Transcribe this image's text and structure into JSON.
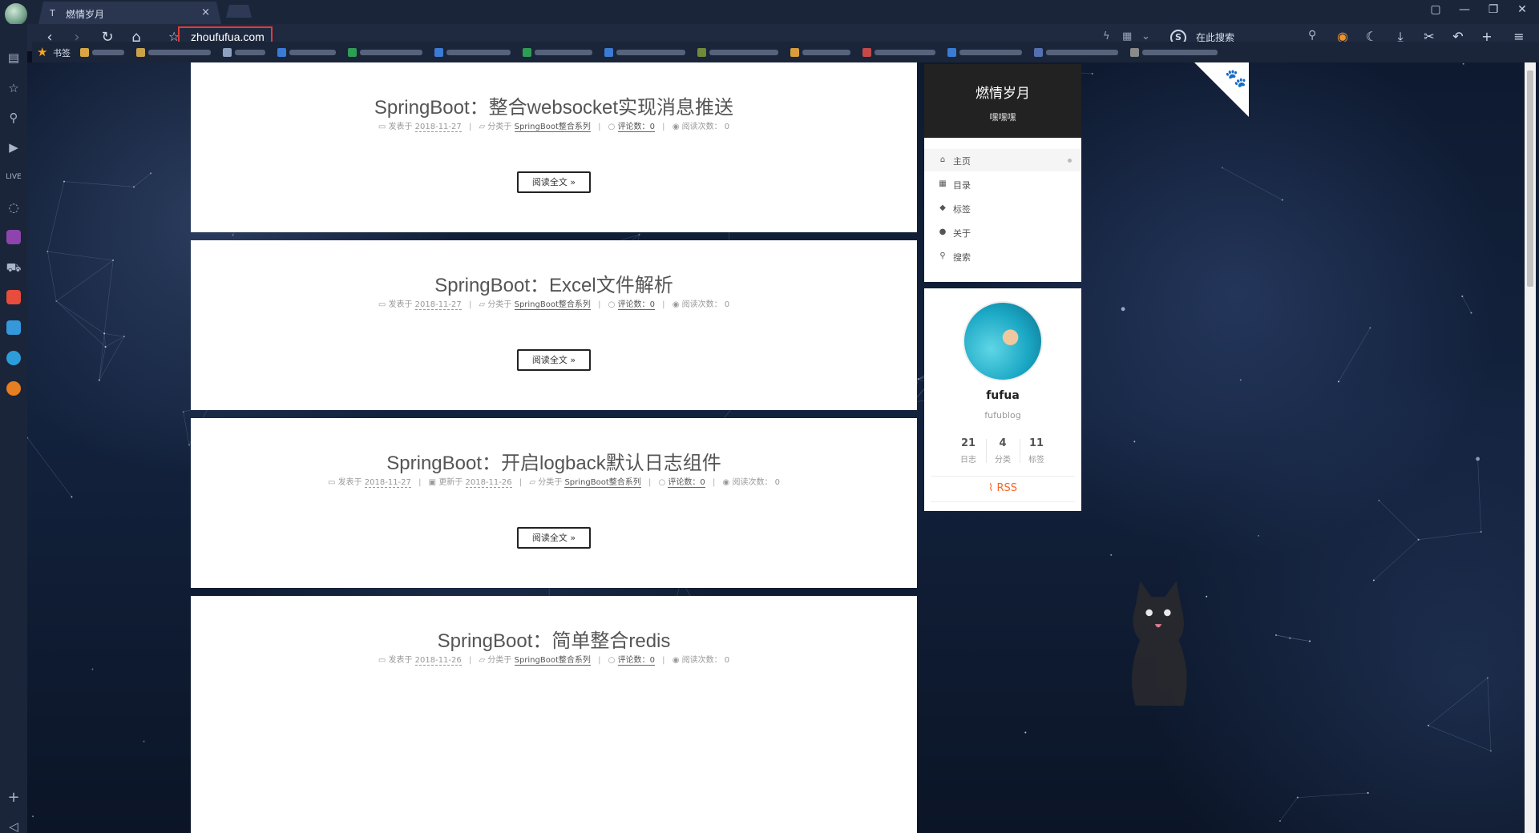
{
  "browser": {
    "tab": {
      "title": "燃情岁月",
      "close": "×"
    },
    "address": "zhoufufua.com",
    "search_placeholder": "在此搜索",
    "search_engine_glyph": "S",
    "window_controls": [
      "▢",
      "—",
      "❐",
      "✕"
    ],
    "bookmarks_label": "书签",
    "bookmark_colors": [
      "#d9a441",
      "#c9a24a",
      "#8fa0c0",
      "#3a7bd5",
      "#2e9d55",
      "#3a7bd5",
      "#2e9d55",
      "#3a7bd5",
      "#6e8a3a",
      "#d99c3a",
      "#c44a4a",
      "#3a7bd5",
      "#5570b0",
      "#8a8a8a"
    ]
  },
  "left_sidebar": {
    "icons": [
      "news-icon",
      "star-icon",
      "search-icon",
      "video-icon",
      "live-icon",
      "chat-icon",
      "translate-icon",
      "cart-icon",
      "stocks-icon",
      "weather-icon",
      "browser-icon",
      "game-icon",
      "add-icon",
      "collapse-icon"
    ],
    "bottom_add": "+",
    "bottom_collapse": "◁"
  },
  "posts": [
    {
      "title": "SpringBoot：整合websocket实现消息推送",
      "posted_label": "发表于",
      "posted_date": "2018-11-27",
      "category_label": "分类于",
      "category": "SpringBoot整合系列",
      "comments_label": "评论数：",
      "comments": "0",
      "views_label": "阅读次数：",
      "views": "0",
      "read_more": "阅读全文 »"
    },
    {
      "title": "SpringBoot：Excel文件解析",
      "posted_label": "发表于",
      "posted_date": "2018-11-27",
      "category_label": "分类于",
      "category": "SpringBoot整合系列",
      "comments_label": "评论数：",
      "comments": "0",
      "views_label": "阅读次数：",
      "views": "0",
      "read_more": "阅读全文 »"
    },
    {
      "title": "SpringBoot：开启logback默认日志组件",
      "posted_label": "发表于",
      "posted_date": "2018-11-27",
      "updated_label": "更新于",
      "updated_date": "2018-11-26",
      "category_label": "分类于",
      "category": "SpringBoot整合系列",
      "comments_label": "评论数：",
      "comments": "0",
      "views_label": "阅读次数：",
      "views": "0",
      "read_more": "阅读全文 »"
    },
    {
      "title": "SpringBoot：简单整合redis",
      "posted_label": "发表于",
      "posted_date": "2018-11-26",
      "category_label": "分类于",
      "category": "SpringBoot整合系列",
      "comments_label": "评论数：",
      "comments": "0",
      "views_label": "阅读次数：",
      "views": "0"
    }
  ],
  "site": {
    "title": "燃情岁月",
    "subtitle": "嘿嘿嘿"
  },
  "menu": [
    {
      "icon": "home-icon",
      "glyph": "⌂",
      "label": "主页"
    },
    {
      "icon": "grid-icon",
      "glyph": "▦",
      "label": "目录"
    },
    {
      "icon": "tags-icon",
      "glyph": "◆",
      "label": "标签"
    },
    {
      "icon": "user-icon",
      "glyph": "●",
      "label": "关于"
    },
    {
      "icon": "search-icon",
      "glyph": "⚲",
      "label": "搜索"
    }
  ],
  "profile": {
    "name": "fufua",
    "description": "fufublog",
    "stats": [
      {
        "count": "21",
        "label": "日志"
      },
      {
        "count": "4",
        "label": "分类"
      },
      {
        "count": "11",
        "label": "标签"
      }
    ],
    "rss": "RSS",
    "rss_glyph": "⌇"
  },
  "colors": {
    "accent_rss": "#fc6423",
    "brand_bg": "#222222",
    "url_highlight": "#e53935"
  }
}
